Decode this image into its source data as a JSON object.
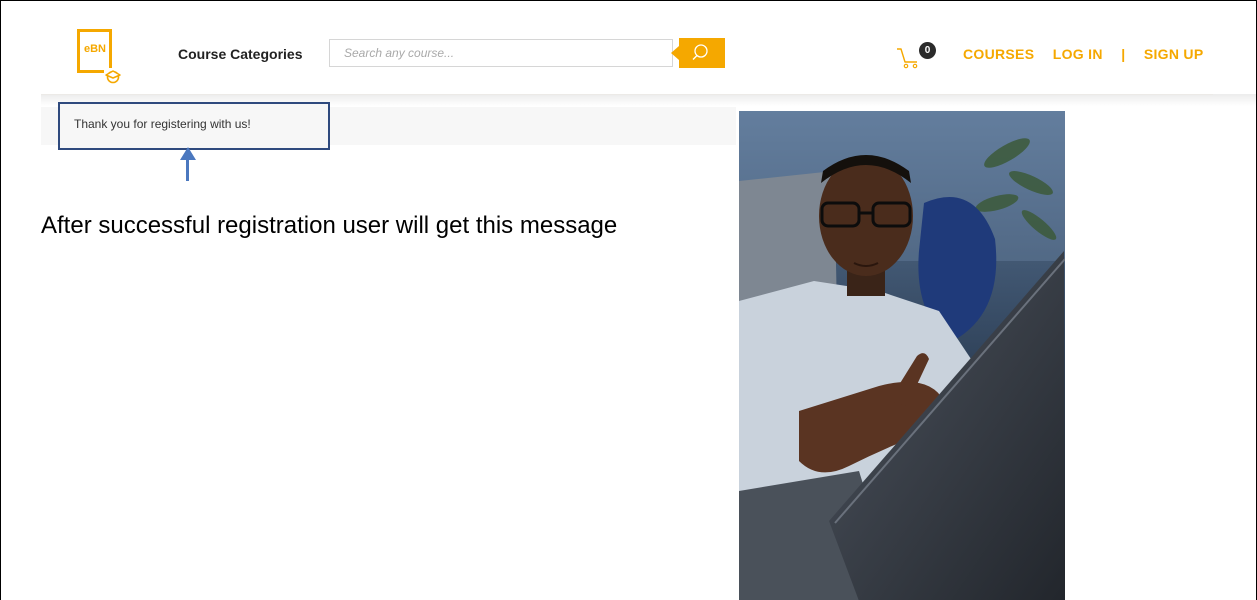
{
  "header": {
    "logo_text": "eBN",
    "categories_label": "Course Categories",
    "search": {
      "placeholder": "Search any course...",
      "icon": "search-icon"
    },
    "cart": {
      "icon": "shopping-cart-icon",
      "count": "0"
    },
    "nav": {
      "courses": "COURSES",
      "login": "LOG IN",
      "separator": "|",
      "signup": "SIGN UP"
    }
  },
  "notification": {
    "message": "Thank you for registering with us!"
  },
  "annotation": {
    "text": "After successful registration user will get this message"
  },
  "colors": {
    "accent": "#f5a800",
    "highlight_border": "#2f4a7e",
    "arrow": "#4b78bf"
  }
}
